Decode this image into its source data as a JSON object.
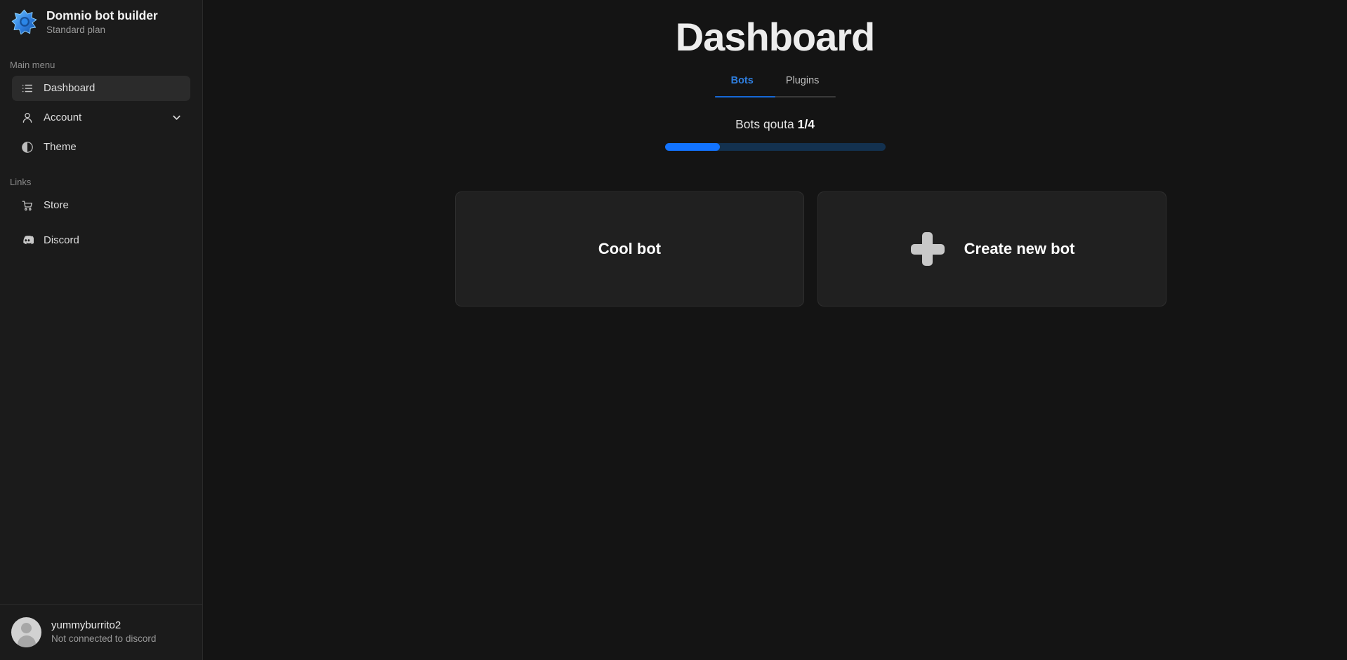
{
  "brand": {
    "logo_icon": "domnio-star-logo",
    "title": "Domnio bot builder",
    "plan": "Standard plan"
  },
  "sidebar": {
    "main_menu_label": "Main menu",
    "links_label": "Links",
    "main_items": [
      {
        "label": "Dashboard",
        "icon": "list-icon",
        "active": true
      },
      {
        "label": "Account",
        "icon": "user-icon",
        "active": false,
        "chevron": "chevron-down-icon"
      },
      {
        "label": "Theme",
        "icon": "contrast-icon",
        "active": false
      }
    ],
    "link_items": [
      {
        "label": "Store",
        "icon": "shopping-cart-icon"
      },
      {
        "label": "Discord",
        "icon": "discord-icon"
      }
    ],
    "footer": {
      "avatar_icon": "default-avatar-icon",
      "username": "yummyburrito2",
      "status": "Not connected to discord"
    }
  },
  "main": {
    "page_title": "Dashboard",
    "tabs": [
      {
        "label": "Bots",
        "active": true
      },
      {
        "label": "Plugins",
        "active": false
      }
    ],
    "quota": {
      "label": "Bots qouta",
      "value": "1/4",
      "used": 1,
      "total": 4,
      "percent": 25
    },
    "cards": [
      {
        "type": "bot",
        "title": "Cool bot",
        "icon": null
      },
      {
        "type": "create",
        "title": "Create new bot",
        "icon": "plus-icon"
      }
    ]
  },
  "colors": {
    "accent_blue": "#1273ff",
    "tab_active": "#2f7fe0",
    "sidebar_bg": "#1b1b1b",
    "main_bg": "#141414",
    "card_bg": "#202020",
    "quota_track": "#13314f"
  }
}
